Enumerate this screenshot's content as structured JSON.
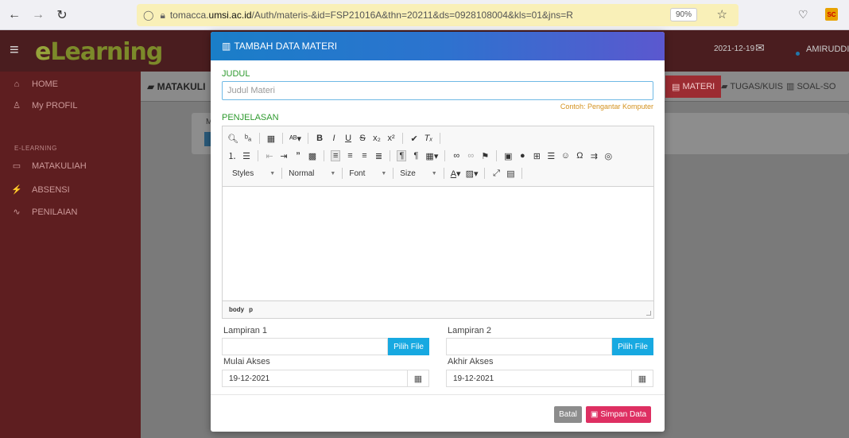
{
  "browser": {
    "url_prefix": "tomacca.",
    "url_domain": "umsi.ac.id",
    "url_path": "/Auth/materis-&id=FSP21016A&thn=20211&ds=0928108004&kls=01&jns=R",
    "zoom": "90%",
    "ext_label": "SC"
  },
  "header": {
    "logo_e": "e",
    "logo_rest": "Learning",
    "date": "2021-12-19",
    "user": "AMIRUDDIN"
  },
  "sidebar": {
    "home": "HOME",
    "profile": "My PROFIL",
    "section": "E-LEARNING",
    "matakuliah": "MATAKULIAH",
    "absensi": "ABSENSI",
    "penilaian": "PENILAIAN"
  },
  "tabs": {
    "matakuliah": "MATAKULI",
    "materi": "MATERI",
    "tugas": "TUGAS/KUIS",
    "soal": "SOAL-SO"
  },
  "modal": {
    "title": "TAMBAH DATA MATERI",
    "judul_label": "JUDUL",
    "judul_placeholder": "Judul Materi",
    "judul_hint": "Contoh: Pengantar Komputer",
    "penjelasan_label": "PENJELASAN",
    "editor": {
      "styles": "Styles",
      "format": "Normal",
      "font": "Font",
      "size": "Size",
      "status_body": "body",
      "status_p": "p"
    },
    "lampiran1_label": "Lampiran 1",
    "lampiran2_label": "Lampiran 2",
    "pilih_file": "Pilih File",
    "mulai_label": "Mulai Akses",
    "akhir_label": "Akhir Akses",
    "mulai_value": "19-12-2021",
    "akhir_value": "19-12-2021",
    "batal": "Batal",
    "simpan": "Simpan Data"
  }
}
